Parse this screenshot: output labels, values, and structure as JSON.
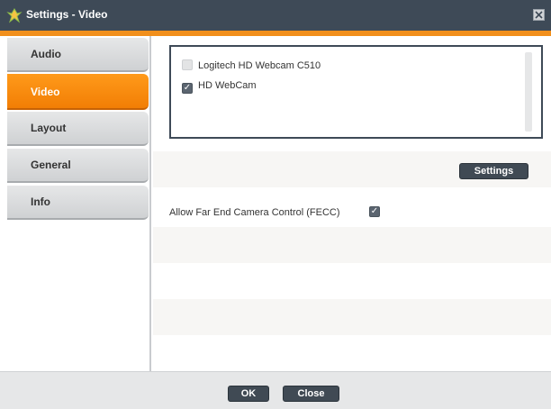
{
  "window": {
    "title": "Settings - Video"
  },
  "sidebar": {
    "tabs": [
      {
        "label": "Audio",
        "active": false
      },
      {
        "label": "Video",
        "active": true
      },
      {
        "label": "Layout",
        "active": false
      },
      {
        "label": "General",
        "active": false
      },
      {
        "label": "Info",
        "active": false
      }
    ]
  },
  "video": {
    "devices": [
      {
        "label": "Logitech HD Webcam C510",
        "checked": false
      },
      {
        "label": "HD WebCam",
        "checked": true
      }
    ],
    "settings_button": "Settings",
    "fecc": {
      "label": "Allow Far End Camera Control (FECC)",
      "checked": true
    }
  },
  "footer": {
    "ok": "OK",
    "close": "Close"
  },
  "colors": {
    "titlebar": "#3e4a57",
    "accent": "#f18f1c",
    "button": "#404a54",
    "active_tab": "#f27e05"
  }
}
